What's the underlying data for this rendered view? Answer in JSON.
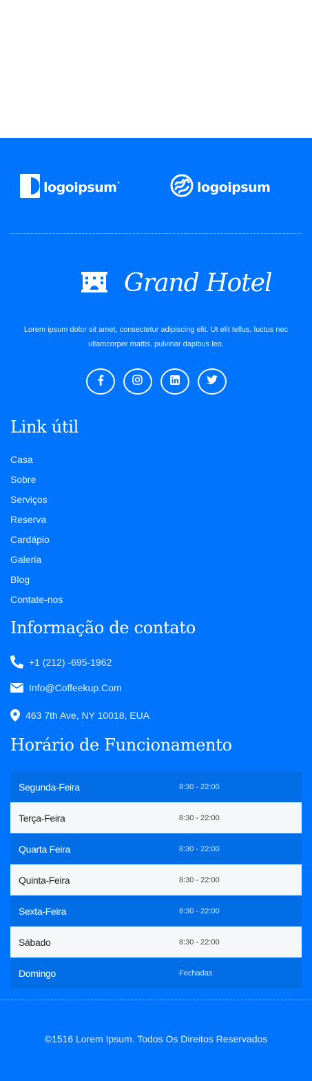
{
  "logos": [
    {
      "icon": "logoipsum-mark-1-icon",
      "text": "logoipsum",
      "suffix": "•"
    },
    {
      "icon": "logoipsum-mark-2-icon",
      "text": "logoipsum",
      "suffix": ""
    }
  ],
  "brand": {
    "icon": "hotel-building-icon",
    "name": "Grand Hotel"
  },
  "description": "Lorem ipsum dolor sit amet, consectetur adipiscing elit. Ut elit tellus, luctus nec ullamcorper mattis, pulvinar dapibus leo.",
  "socials": [
    {
      "icon": "facebook-icon"
    },
    {
      "icon": "instagram-icon"
    },
    {
      "icon": "linkedin-icon"
    },
    {
      "icon": "twitter-icon"
    }
  ],
  "useful_links": {
    "title": "Link útil",
    "items": [
      "Casa",
      "Sobre",
      "Serviços",
      "Reserva",
      "Cardápio",
      "Galeria",
      "Blog",
      "Contate-nos"
    ]
  },
  "contact": {
    "title": "Informação de contato",
    "phone": {
      "icon": "phone-icon",
      "text": "+1 (212) -695-1962"
    },
    "email": {
      "icon": "envelope-icon",
      "text": "Info@Coffeekup.Com"
    },
    "address": {
      "icon": "map-pin-icon",
      "text": "463 7th Ave, NY 10018, EUA"
    }
  },
  "hours": {
    "title": "Horário de Funcionamento",
    "rows": [
      {
        "day": "Segunda-Feira",
        "time": "8:30 - 22:00"
      },
      {
        "day": "Terça-Feira",
        "time": "8:30 - 22:00"
      },
      {
        "day": "Quarta Feira",
        "time": "8:30 - 22:00"
      },
      {
        "day": "Quinta-Feira",
        "time": "8:30 - 22:00"
      },
      {
        "day": "Sexta-Feira",
        "time": "8:30 - 22:00"
      },
      {
        "day": "Sábado",
        "time": "8:30 - 22:00"
      },
      {
        "day": "Domingo",
        "time": "Fechadas"
      }
    ]
  },
  "copyright": "©1516 Lorem Ipsum. Todos Os Direitos Reservados",
  "colors": {
    "footer_bg": "#0174fe",
    "row_blue": "#036de6",
    "row_white": "#f6f7f9",
    "text": "#ffffff"
  }
}
